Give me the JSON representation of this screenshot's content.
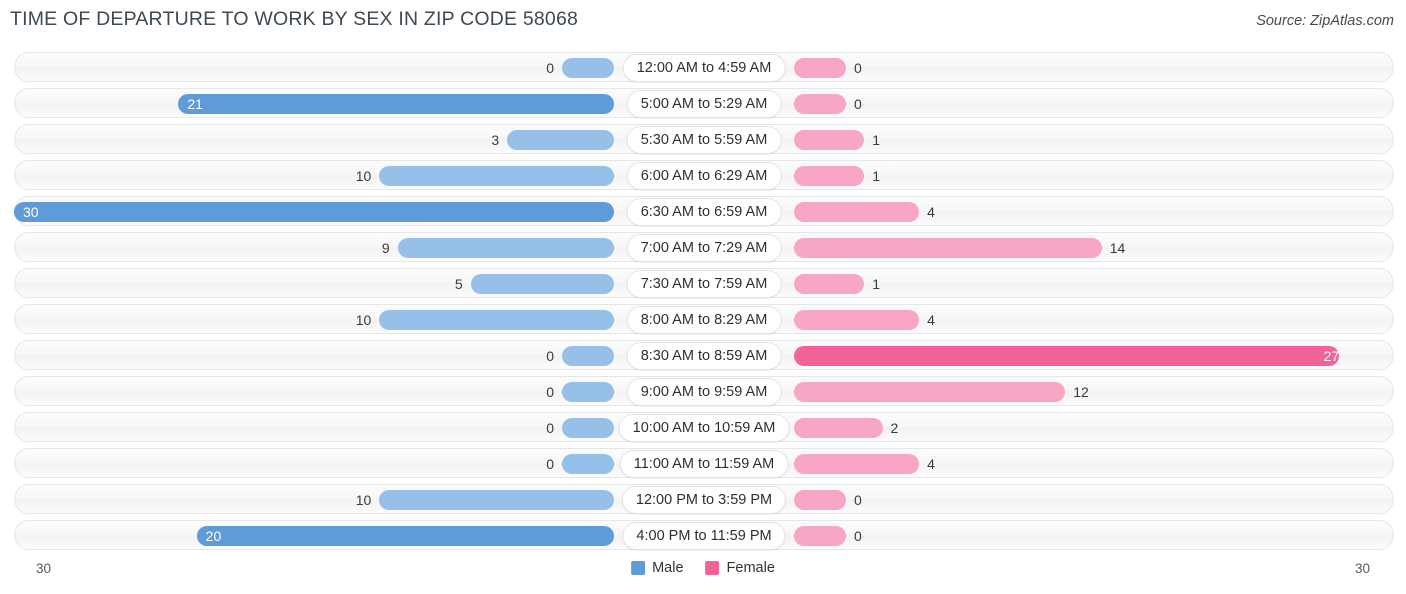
{
  "header": {
    "title": "TIME OF DEPARTURE TO WORK BY SEX IN ZIP CODE 58068",
    "source": "Source: ZipAtlas.com"
  },
  "legend": {
    "male_label": "Male",
    "female_label": "Female",
    "male_color": "#5e9bd8",
    "female_color": "#f2639a"
  },
  "axis": {
    "left_max_label": "30",
    "right_max_label": "30"
  },
  "chart_data": {
    "type": "bar",
    "title": "TIME OF DEPARTURE TO WORK BY SEX IN ZIP CODE 58068",
    "subtitle": "",
    "xlabel": "",
    "ylabel": "",
    "orientation": "horizontal-diverging",
    "xlim": [
      30,
      30
    ],
    "grid": false,
    "legend_position": "bottom-center",
    "categories": [
      "12:00 AM to 4:59 AM",
      "5:00 AM to 5:29 AM",
      "5:30 AM to 5:59 AM",
      "6:00 AM to 6:29 AM",
      "6:30 AM to 6:59 AM",
      "7:00 AM to 7:29 AM",
      "7:30 AM to 7:59 AM",
      "8:00 AM to 8:29 AM",
      "8:30 AM to 8:59 AM",
      "9:00 AM to 9:59 AM",
      "10:00 AM to 10:59 AM",
      "11:00 AM to 11:59 AM",
      "12:00 PM to 3:59 PM",
      "4:00 PM to 11:59 PM"
    ],
    "series": [
      {
        "name": "Male",
        "values": [
          0,
          21,
          3,
          10,
          30,
          9,
          5,
          10,
          0,
          0,
          0,
          0,
          10,
          20
        ]
      },
      {
        "name": "Female",
        "values": [
          0,
          0,
          1,
          1,
          4,
          14,
          1,
          4,
          27,
          12,
          2,
          4,
          0,
          0
        ]
      }
    ]
  },
  "rows": [
    {
      "label": "12:00 AM to 4:59 AM",
      "male": "0",
      "female": "0",
      "male_v": 0,
      "female_v": 0
    },
    {
      "label": "5:00 AM to 5:29 AM",
      "male": "21",
      "female": "0",
      "male_v": 21,
      "female_v": 0
    },
    {
      "label": "5:30 AM to 5:59 AM",
      "male": "3",
      "female": "1",
      "male_v": 3,
      "female_v": 1
    },
    {
      "label": "6:00 AM to 6:29 AM",
      "male": "10",
      "female": "1",
      "male_v": 10,
      "female_v": 1
    },
    {
      "label": "6:30 AM to 6:59 AM",
      "male": "30",
      "female": "4",
      "male_v": 30,
      "female_v": 4
    },
    {
      "label": "7:00 AM to 7:29 AM",
      "male": "9",
      "female": "14",
      "male_v": 9,
      "female_v": 14
    },
    {
      "label": "7:30 AM to 7:59 AM",
      "male": "5",
      "female": "1",
      "male_v": 5,
      "female_v": 1
    },
    {
      "label": "8:00 AM to 8:29 AM",
      "male": "10",
      "female": "4",
      "male_v": 10,
      "female_v": 4
    },
    {
      "label": "8:30 AM to 8:59 AM",
      "male": "0",
      "female": "27",
      "male_v": 0,
      "female_v": 27
    },
    {
      "label": "9:00 AM to 9:59 AM",
      "male": "0",
      "female": "12",
      "male_v": 0,
      "female_v": 12
    },
    {
      "label": "10:00 AM to 10:59 AM",
      "male": "0",
      "female": "2",
      "male_v": 0,
      "female_v": 2
    },
    {
      "label": "11:00 AM to 11:59 AM",
      "male": "0",
      "female": "4",
      "male_v": 0,
      "female_v": 4
    },
    {
      "label": "12:00 PM to 3:59 PM",
      "male": "10",
      "female": "0",
      "male_v": 10,
      "female_v": 0
    },
    {
      "label": "4:00 PM to 11:59 PM",
      "male": "20",
      "female": "0",
      "male_v": 20,
      "female_v": 0
    }
  ]
}
